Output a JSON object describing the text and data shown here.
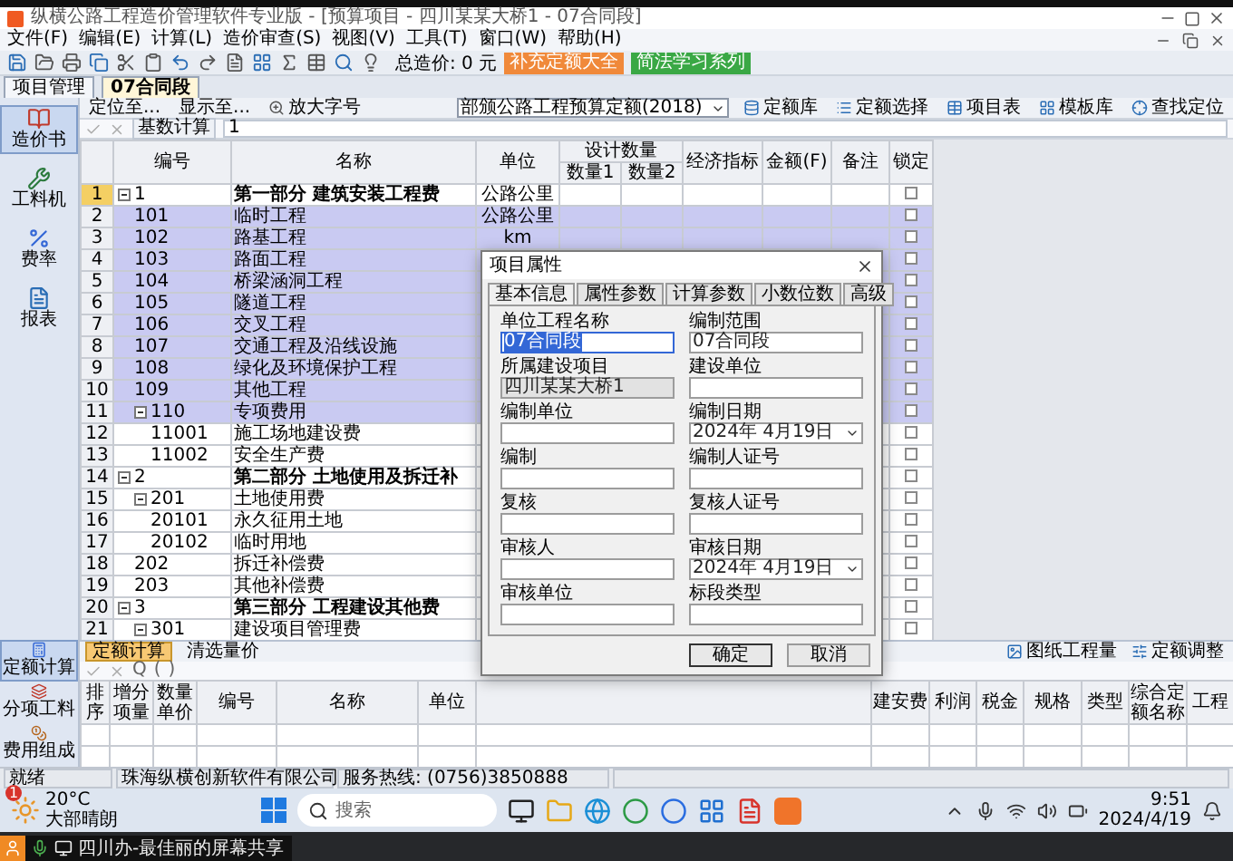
{
  "window": {
    "title": "纵横公路工程造价管理软件专业版 - [预算项目 - 四川某某大桥1 - 07合同段]"
  },
  "menu": [
    "文件(F)",
    "编辑(E)",
    "计算(L)",
    "造价审查(S)",
    "视图(V)",
    "工具(T)",
    "窗口(W)",
    "帮助(H)"
  ],
  "toolbar": {
    "total": "总造价: 0 元",
    "buttons": [
      {
        "label": "补充定额大全",
        "color": "#f0893a"
      },
      {
        "label": "简法学习系列",
        "color": "#3aa845"
      }
    ]
  },
  "doc_tabs": [
    {
      "label": "项目管理",
      "selected": false
    },
    {
      "label": "07合同段",
      "selected": true
    }
  ],
  "locate_bar": {
    "left": [
      "定位至...",
      "显示至..."
    ],
    "zoom_font": "放大字号",
    "quota_select": "部颁公路工程预算定额(2018)",
    "right": [
      "定额库",
      "定额选择",
      "项目表",
      "模板库",
      "查找定位"
    ]
  },
  "edit_bar": {
    "field": "基数计算",
    "value": "1"
  },
  "sidebar": {
    "top": [
      {
        "label": "造价书",
        "selected": true
      },
      {
        "label": "工料机",
        "selected": false
      },
      {
        "label": "费率",
        "selected": false
      },
      {
        "label": "报表",
        "selected": false
      }
    ],
    "bottom": [
      {
        "label": "定额计算",
        "selected": true
      },
      {
        "label": "分项工料",
        "selected": false
      },
      {
        "label": "费用组成",
        "selected": false
      }
    ]
  },
  "table": {
    "columns_before": [
      "编号",
      "名称",
      "单位"
    ],
    "group": {
      "label": "设计数量",
      "sub": [
        "数量1",
        "数量2"
      ]
    },
    "columns_after": [
      "经济指标",
      "金额(F)",
      "备注",
      "锁定"
    ],
    "rows": [
      {
        "no": "1",
        "code": "1",
        "name": "第一部分 建筑安装工程费",
        "unit": "公路公里",
        "kind": "part",
        "current": true,
        "selected": false,
        "locked": false,
        "expanded": true,
        "children": [
          {
            "no": "2",
            "code": "101",
            "name": "临时工程",
            "unit": "公路公里",
            "kind": "item",
            "current": false,
            "selected": true,
            "locked": false
          },
          {
            "no": "3",
            "code": "102",
            "name": "路基工程",
            "unit": "km",
            "kind": "item",
            "current": false,
            "selected": true,
            "locked": false
          },
          {
            "no": "4",
            "code": "103",
            "name": "路面工程",
            "kind": "item",
            "current": false,
            "selected": true,
            "locked": false
          },
          {
            "no": "5",
            "code": "104",
            "name": "桥梁涵洞工程",
            "kind": "item",
            "current": false,
            "selected": true,
            "locked": false
          },
          {
            "no": "6",
            "code": "105",
            "name": "隧道工程",
            "kind": "item",
            "current": false,
            "selected": true,
            "locked": false
          },
          {
            "no": "7",
            "code": "106",
            "name": "交叉工程",
            "kind": "item",
            "current": false,
            "selected": true,
            "locked": false
          },
          {
            "no": "8",
            "code": "107",
            "name": "交通工程及沿线设施",
            "kind": "item",
            "current": false,
            "selected": true,
            "locked": false
          },
          {
            "no": "9",
            "code": "108",
            "name": "绿化及环境保护工程",
            "kind": "item",
            "current": false,
            "selected": true,
            "locked": false
          },
          {
            "no": "10",
            "code": "109",
            "name": "其他工程",
            "kind": "item",
            "current": false,
            "selected": true,
            "locked": false
          },
          {
            "no": "11",
            "code": "110",
            "name": "专项费用",
            "kind": "item",
            "current": false,
            "selected": true,
            "locked": false,
            "expanded": true,
            "children": [
              {
                "no": "12",
                "code": "11001",
                "name": "施工场地建设费",
                "kind": "item",
                "current": false,
                "selected": false,
                "locked": false
              },
              {
                "no": "13",
                "code": "11002",
                "name": "安全生产费",
                "kind": "item",
                "current": false,
                "selected": false,
                "locked": false
              }
            ]
          }
        ]
      },
      {
        "no": "14",
        "code": "2",
        "name": "第二部分 土地使用及拆迁补",
        "kind": "part",
        "current": false,
        "selected": false,
        "locked": false,
        "expanded": true,
        "children": [
          {
            "no": "15",
            "code": "201",
            "name": "土地使用费",
            "kind": "item",
            "current": false,
            "selected": false,
            "locked": false,
            "expanded": true,
            "children": [
              {
                "no": "16",
                "code": "20101",
                "name": "永久征用土地",
                "kind": "item",
                "current": false,
                "selected": false,
                "locked": false
              },
              {
                "no": "17",
                "code": "20102",
                "name": "临时用地",
                "kind": "item",
                "current": false,
                "selected": false,
                "locked": false
              }
            ]
          },
          {
            "no": "18",
            "code": "202",
            "name": "拆迁补偿费",
            "kind": "item",
            "current": false,
            "selected": false,
            "locked": false
          },
          {
            "no": "19",
            "code": "203",
            "name": "其他补偿费",
            "kind": "item",
            "current": false,
            "selected": false,
            "locked": false
          }
        ]
      },
      {
        "no": "20",
        "code": "3",
        "name": "第三部分 工程建设其他费",
        "kind": "part",
        "current": false,
        "selected": false,
        "locked": false,
        "expanded": true,
        "children": [
          {
            "no": "21",
            "code": "301",
            "name": "建设项目管理费",
            "kind": "item",
            "current": false,
            "selected": false,
            "locked": false,
            "expanded": true
          }
        ]
      }
    ]
  },
  "dialog": {
    "title": "项目属性",
    "tabs": [
      {
        "label": "基本信息",
        "selected": true
      },
      {
        "label": "属性参数",
        "selected": false
      },
      {
        "label": "计算参数",
        "selected": false
      },
      {
        "label": "小数位数",
        "selected": false
      },
      {
        "label": "高级",
        "selected": false
      }
    ],
    "left_fields": [
      {
        "label": "单位工程名称",
        "value": "07合同段",
        "kind": "text",
        "highlighted": true,
        "disabled": false
      },
      {
        "label": "所属建设项目",
        "value": "四川某某大桥1",
        "kind": "text",
        "highlighted": false,
        "disabled": true
      },
      {
        "label": "编制单位",
        "kind": "text",
        "highlighted": false,
        "disabled": false
      },
      {
        "label": "编制",
        "kind": "text",
        "highlighted": false,
        "disabled": false
      },
      {
        "label": "复核",
        "kind": "text",
        "highlighted": false,
        "disabled": false
      },
      {
        "label": "审核人",
        "kind": "text",
        "highlighted": false,
        "disabled": false
      },
      {
        "label": "审核单位",
        "kind": "text",
        "highlighted": false,
        "disabled": false
      }
    ],
    "right_fields": [
      {
        "label": "编制范围",
        "value": "07合同段",
        "kind": "text",
        "highlighted": false,
        "disabled": false
      },
      {
        "label": "建设单位",
        "kind": "text",
        "highlighted": false,
        "disabled": false
      },
      {
        "label": "编制日期",
        "value": "2024年 4月19日",
        "kind": "date",
        "highlighted": false,
        "disabled": false
      },
      {
        "label": "编制人证号",
        "kind": "text",
        "highlighted": false,
        "disabled": false
      },
      {
        "label": "复核人证号",
        "kind": "text",
        "highlighted": false,
        "disabled": false
      },
      {
        "label": "审核日期",
        "value": "2024年 4月19日",
        "kind": "date",
        "highlighted": false,
        "disabled": false
      },
      {
        "label": "标段类型",
        "kind": "text",
        "highlighted": false,
        "disabled": false
      }
    ],
    "buttons": [
      {
        "label": "确定",
        "default": true
      },
      {
        "label": "取消",
        "default": false
      }
    ]
  },
  "bottom_panel": {
    "tabs": [
      {
        "label": "定额计算",
        "selected": true
      },
      {
        "label": "清选量价",
        "selected": false
      }
    ],
    "tools": [
      "图纸工程量",
      "定额调整"
    ],
    "formula_tools": [
      "Q",
      "(",
      ")"
    ],
    "grid": {
      "columns_left": [
        "排序",
        "增分项量",
        "数量单价",
        "编号",
        "名称",
        "单位"
      ],
      "columns_right": [
        "建安费",
        "利润",
        "税金",
        "规格",
        "类型",
        "综合定额名称",
        "工程"
      ]
    }
  },
  "status_bar": [
    "就绪",
    "珠海纵横创新软件有限公司",
    "服务热线: (0756)3850888"
  ],
  "taskbar": {
    "weather": {
      "badge": "1",
      "temp": "20°C",
      "desc": "大部晴朗"
    },
    "search": {
      "placeholder": "搜索"
    },
    "clock": {
      "time": "9:51",
      "date": "2024/4/19"
    }
  },
  "share_bar": {
    "text": "四川办-最佳丽的屏幕共享"
  }
}
